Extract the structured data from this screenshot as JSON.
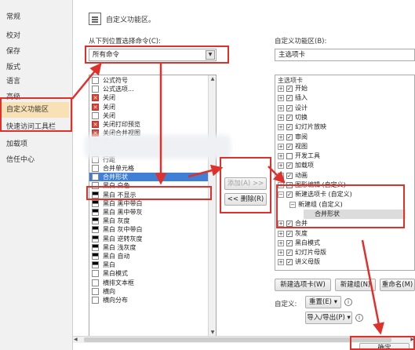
{
  "nav": {
    "items": [
      {
        "label": "常规"
      },
      {
        "label": "校对"
      },
      {
        "label": "保存"
      },
      {
        "label": "版式"
      },
      {
        "label": "语言"
      },
      {
        "label": "高级"
      },
      {
        "label": "自定义功能区"
      },
      {
        "label": "快速访问工具栏"
      },
      {
        "label": "加载项"
      },
      {
        "label": "信任中心"
      }
    ]
  },
  "header": {
    "title": "自定义功能区。"
  },
  "left_panel": {
    "choose_label": "从下列位置选择命令(C):",
    "choose_value": "所有命令",
    "commands": [
      {
        "icon": "",
        "label": "公式符号"
      },
      {
        "icon": "",
        "label": "公式选项..."
      },
      {
        "icon": "✕",
        "label": "关闭"
      },
      {
        "icon": "✕",
        "label": "关闭"
      },
      {
        "icon": "",
        "label": "关闭"
      },
      {
        "icon": "✕",
        "label": "关闭打印预览"
      },
      {
        "icon": "✕",
        "label": "关闭合并视图"
      },
      {
        "icon": "?",
        "label": "关于..."
      },
      {
        "icon": "",
        "label": "函数"
      },
      {
        "icon": "",
        "label": "行距"
      },
      {
        "icon": "",
        "label": "合并单元格"
      },
      {
        "icon": "",
        "label": "合并形状"
      },
      {
        "icon": "",
        "label": "黑白 白色"
      },
      {
        "icon": "",
        "label": "黑白 不显示"
      },
      {
        "icon": "",
        "label": "黑白 黑中带白"
      },
      {
        "icon": "",
        "label": "黑白 黑中带灰"
      },
      {
        "icon": "",
        "label": "黑白 灰度"
      },
      {
        "icon": "",
        "label": "黑白 灰中带白"
      },
      {
        "icon": "",
        "label": "黑白 逆转灰度"
      },
      {
        "icon": "",
        "label": "黑白 浅灰度"
      },
      {
        "icon": "",
        "label": "黑白 自动"
      },
      {
        "icon": "",
        "label": "黑白"
      },
      {
        "icon": "",
        "label": "黑白模式"
      },
      {
        "icon": "",
        "label": "横排文本框"
      },
      {
        "icon": "",
        "label": "横向"
      },
      {
        "icon": "",
        "label": "横向分布"
      }
    ]
  },
  "middle": {
    "add_label": "添加(A) >>",
    "remove_label": "<< 删除(R)"
  },
  "right_panel": {
    "customize_label": "自定义功能区(B):",
    "customize_value": "主选项卡",
    "tree_header": "主选项卡",
    "tree": [
      {
        "exp": "+",
        "check": "✓",
        "label": "开始"
      },
      {
        "exp": "+",
        "check": "✓",
        "label": "插入"
      },
      {
        "exp": "+",
        "check": "✓",
        "label": "设计"
      },
      {
        "exp": "+",
        "check": "✓",
        "label": "切换"
      },
      {
        "exp": "+",
        "check": "✓",
        "label": "幻灯片放映"
      },
      {
        "exp": "+",
        "check": "✓",
        "label": "审阅"
      },
      {
        "exp": "+",
        "check": "✓",
        "label": "视图"
      },
      {
        "exp": "+",
        "check": "",
        "label": "开发工具"
      },
      {
        "exp": "+",
        "check": "✓",
        "label": "加载项"
      },
      {
        "exp": "+",
        "check": "✓",
        "label": "动画"
      },
      {
        "exp": "+",
        "check": "✓",
        "label": "图形编辑 (自定义)"
      },
      {
        "exp": "−",
        "check": "✓",
        "label": "新建选项卡 (自定义)"
      },
      {
        "exp": "−",
        "check": "",
        "label": "新建组 (自定义)"
      },
      {
        "exp": "",
        "check": "",
        "label": "合并形状"
      },
      {
        "exp": "+",
        "check": "✓",
        "label": "合并"
      },
      {
        "exp": "+",
        "check": "✓",
        "label": "灰度"
      },
      {
        "exp": "+",
        "check": "✓",
        "label": "黑白模式"
      },
      {
        "exp": "+",
        "check": "✓",
        "label": "幻灯片母版"
      },
      {
        "exp": "+",
        "check": "✓",
        "label": "讲义母版"
      }
    ],
    "new_tab_label": "新建选项卡(W)",
    "new_group_label": "新建组(N)",
    "rename_label": "重命名(M)",
    "custom_label": "自定义:",
    "reset_label": "重置(E) ▾",
    "import_export_label": "导入/导出(P) ▾",
    "info_icon": "i"
  },
  "footer": {
    "ok_label": "确定"
  },
  "colors": {
    "accent": "#3f7fd6",
    "annotation": "#e0302c",
    "selected_nav": "#f8e2b5"
  }
}
